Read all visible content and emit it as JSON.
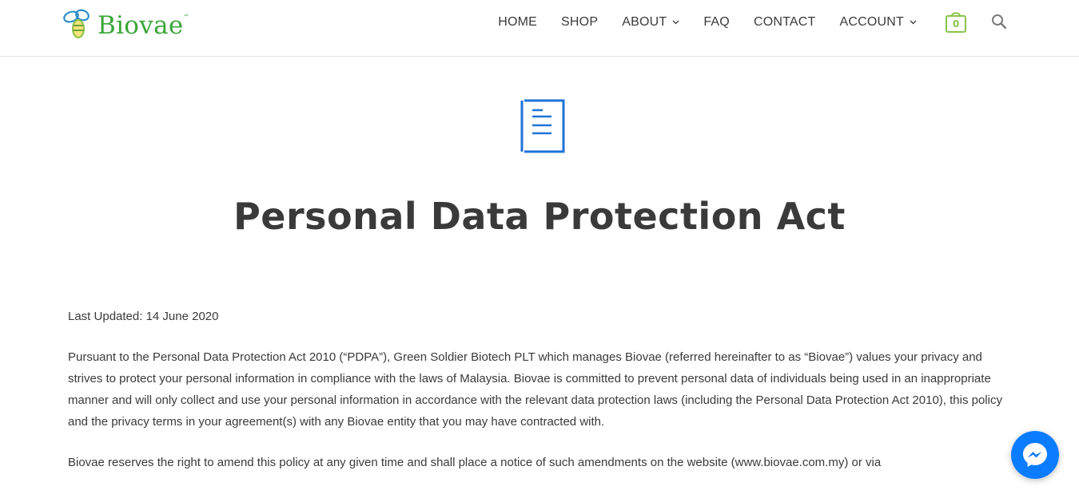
{
  "header": {
    "logo_text": "Biovae",
    "logo_tm": "™",
    "nav": [
      {
        "label": "HOME"
      },
      {
        "label": "SHOP"
      },
      {
        "label": "ABOUT",
        "has_dropdown": true
      },
      {
        "label": "FAQ"
      },
      {
        "label": "CONTACT"
      },
      {
        "label": "ACCOUNT",
        "has_dropdown": true
      }
    ],
    "cart_count": "0",
    "cart_icon": "shopping-bag-icon",
    "search_icon": "search-icon"
  },
  "main": {
    "icon": "document-icon",
    "title": "Personal Data Protection Act",
    "paragraphs": [
      "Last Updated: 14 June 2020",
      "Pursuant to the Personal Data Protection Act 2010 (“PDPA”), Green Soldier Biotech PLT which manages Biovae (referred hereinafter to as “Biovae”) values your privacy and strives to protect your personal information in compliance with the laws of Malaysia. Biovae is committed to prevent personal data of individuals being used in an inappropriate manner and will only collect and use your personal information in accordance with the relevant data protection laws (including the Personal Data Protection Act 2010), this policy and the privacy terms in your agreement(s) with any Biovae entity that you may have contracted with.",
      "Biovae reserves the right to amend this policy at any given time and shall place a notice of such amendments on the website (www.biovae.com.my) or via"
    ]
  },
  "messenger": {
    "icon": "messenger-icon"
  },
  "colors": {
    "brand_green": "#3aa63a",
    "cart_green": "#8bc34a",
    "doc_blue": "#1e73d8",
    "messenger_blue": "#0a7cff",
    "text": "#3a3a3a"
  }
}
